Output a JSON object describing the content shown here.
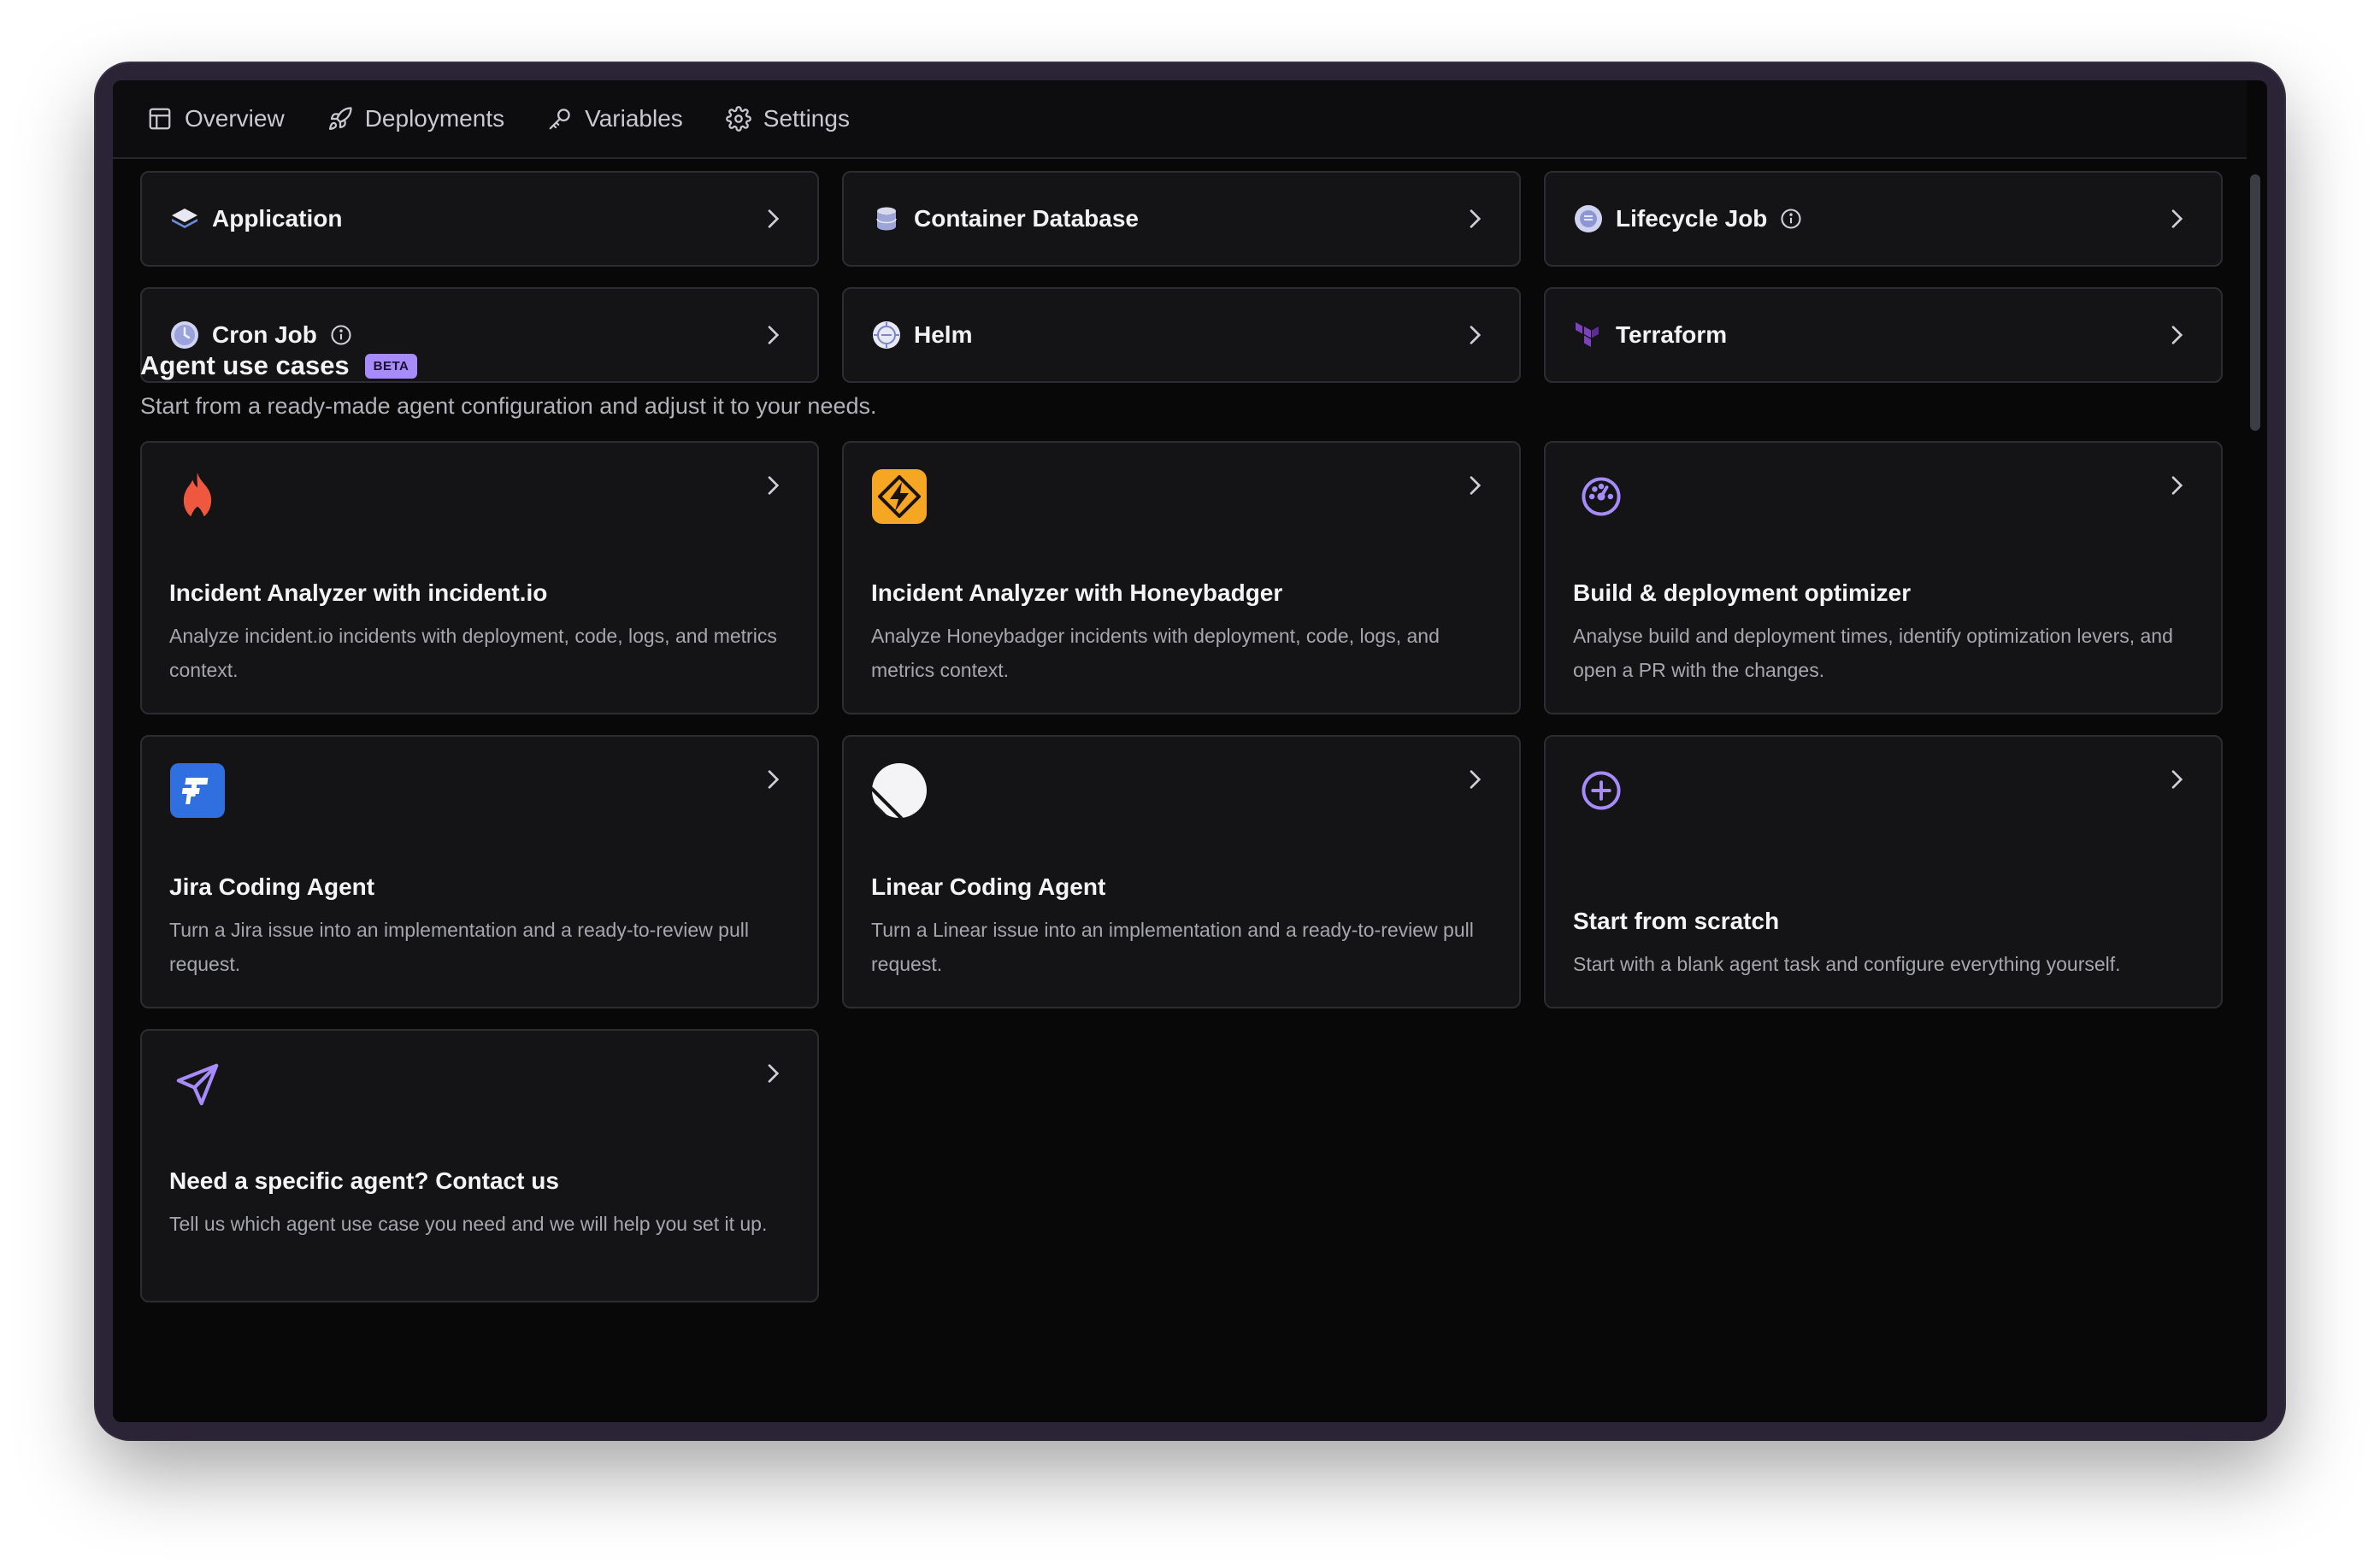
{
  "tabs": [
    {
      "label": "Overview",
      "icon": "layout-icon"
    },
    {
      "label": "Deployments",
      "icon": "rocket-icon"
    },
    {
      "label": "Variables",
      "icon": "key-icon"
    },
    {
      "label": "Settings",
      "icon": "gear-icon"
    }
  ],
  "service_types": [
    {
      "label": "Application",
      "icon": "layers-icon"
    },
    {
      "label": "Container Database",
      "icon": "database-icon"
    },
    {
      "label": "Lifecycle Job",
      "icon": "lifecycle-icon",
      "has_info": true
    },
    {
      "label": "Cron Job",
      "icon": "clock-icon",
      "has_info": true
    },
    {
      "label": "Helm",
      "icon": "helm-icon"
    },
    {
      "label": "Terraform",
      "icon": "terraform-icon"
    }
  ],
  "agent_section": {
    "title": "Agent use cases",
    "badge": "BETA",
    "subtitle": "Start from a ready-made agent configuration and adjust it to your needs."
  },
  "agents": [
    {
      "title": "Incident Analyzer with incident.io",
      "desc": "Analyze incident.io incidents with deployment, code, logs, and metrics context.",
      "icon": "flame-icon"
    },
    {
      "title": "Incident Analyzer with Honeybadger",
      "desc": "Analyze Honeybadger incidents with deployment, code, logs, and metrics context.",
      "icon": "honeybadger-icon"
    },
    {
      "title": "Build & deployment optimizer",
      "desc": "Analyse build and deployment times, identify optimization levers, and open a PR with the changes.",
      "icon": "gauge-icon"
    },
    {
      "title": "Jira Coding Agent",
      "desc": "Turn a Jira issue into an implementation and a ready-to-review pull request.",
      "icon": "jira-icon"
    },
    {
      "title": "Linear Coding Agent",
      "desc": "Turn a Linear issue into an implementation and a ready-to-review pull request.",
      "icon": "linear-icon"
    },
    {
      "title": "Start from scratch",
      "desc": "Start with a blank agent task and configure everything yourself.",
      "icon": "plus-circle-icon"
    },
    {
      "title": "Need a specific agent? Contact us",
      "desc": "Tell us which agent use case you need and we will help you set it up.",
      "icon": "send-icon"
    }
  ],
  "colors": {
    "accent": "#a78bfa",
    "background": "#080809",
    "card": "#141416",
    "border": "#2c2c32"
  }
}
